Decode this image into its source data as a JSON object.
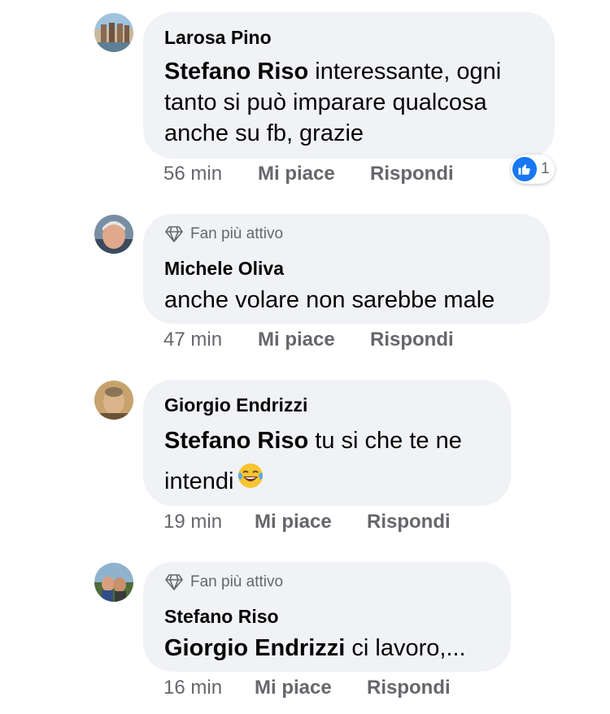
{
  "comments": [
    {
      "author": "Larosa Pino",
      "badge": "",
      "mention": "Stefano Riso",
      "text_lines": [
        " interessante, ogni",
        "tanto si può imparare qualcosa",
        "anche su fb, grazie"
      ],
      "time": "56 min",
      "like_label": "Mi piace",
      "reply_label": "Rispondi",
      "reaction": {
        "icon": "thumbs-up-icon",
        "count": "1"
      }
    },
    {
      "author": "Michele Oliva",
      "badge": "Fan più attivo",
      "mention": "",
      "text_lines": [
        "anche volare non sarebbe male"
      ],
      "time": "47 min",
      "like_label": "Mi piace",
      "reply_label": "Rispondi"
    },
    {
      "author": "Giorgio Endrizzi",
      "badge": "",
      "mention": "Stefano Riso",
      "text_lines": [
        " tu si che te ne",
        "intendi"
      ],
      "emoji": "tears-of-joy-emoji",
      "time": "19 min",
      "like_label": "Mi piace",
      "reply_label": "Rispondi"
    },
    {
      "author": "Stefano Riso",
      "badge": "Fan più attivo",
      "mention": "Giorgio Endrizzi",
      "text_lines": [
        " ci lavoro,..."
      ],
      "time": "16 min",
      "like_label": "Mi piace",
      "reply_label": "Rispondi"
    }
  ],
  "colors": {
    "bubble": "#f0f2f5",
    "text": "#050505",
    "meta": "#65676b",
    "like_blue": "#1877f2"
  }
}
